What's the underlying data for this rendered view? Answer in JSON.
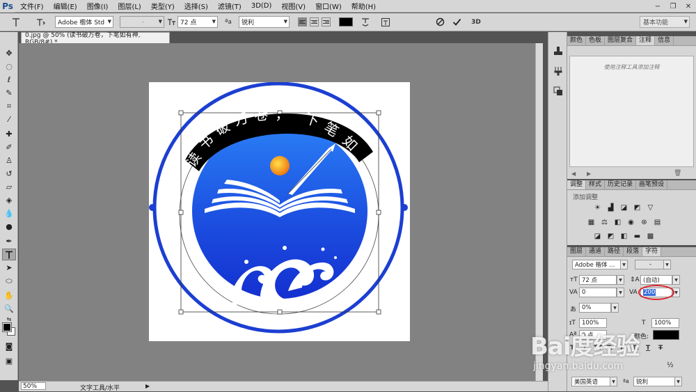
{
  "app": {
    "logo": "Ps"
  },
  "menu": [
    "文件(F)",
    "编辑(E)",
    "图像(I)",
    "图层(L)",
    "类型(Y)",
    "选择(S)",
    "滤镜(T)",
    "3D(D)",
    "视图(V)",
    "窗口(W)",
    "帮助(H)"
  ],
  "window_controls": {
    "minimize": "−",
    "restore": "❐",
    "close": "✕"
  },
  "options_bar": {
    "font_family": "Adobe 楷体 Std",
    "font_style": "-",
    "font_size": "72 点",
    "aa_label": "ªa",
    "antialias": "锐利",
    "workspace": "基本功能"
  },
  "document": {
    "tab_title": "0.jpg @ 50% (读书破万卷，下笔如有神, RGB/8#) *",
    "arc_text": [
      "读",
      "书",
      "破",
      "万",
      "卷",
      "，",
      "下",
      "笔",
      "如"
    ]
  },
  "status": {
    "zoom": "50%",
    "tool_info": "文字工具/水平"
  },
  "panels": {
    "notes_tabs": [
      "颜色",
      "色板",
      "图层复合",
      "注释",
      "信息"
    ],
    "notes_active": "注释",
    "notes_hint": "使用注释工具添加注释",
    "adjust_tabs": [
      "调整",
      "样式",
      "历史记录",
      "画笔预设"
    ],
    "adjust_active": "调整",
    "adjust_add_label": "添加调整",
    "char_tabs": [
      "图层",
      "通道",
      "路径",
      "段落",
      "字符"
    ],
    "char_active": "字符"
  },
  "character": {
    "font_family": "Adobe 楷体 ...",
    "font_style": "-",
    "size": "72 点",
    "leading": "(自动)",
    "kerning": "0",
    "tracking": "200",
    "tsume": "0%",
    "vscale": "100%",
    "hscale": "100%",
    "baseline": "0 点",
    "color_label": "颜色:",
    "language": "美国英语",
    "antialias_label": "ªa",
    "antialias": "锐利",
    "format_buttons": [
      "T",
      "T",
      "TT",
      "Tr",
      "T¹",
      "T₁",
      "T",
      "T"
    ],
    "fraction": "½"
  },
  "watermark": {
    "main": "Bai度经验",
    "sub": "jingyan.baidu.com"
  },
  "colors": {
    "logo_blue": "#1c3fd1",
    "highlight": "#e0212b",
    "selection": "#3a6fd8"
  }
}
